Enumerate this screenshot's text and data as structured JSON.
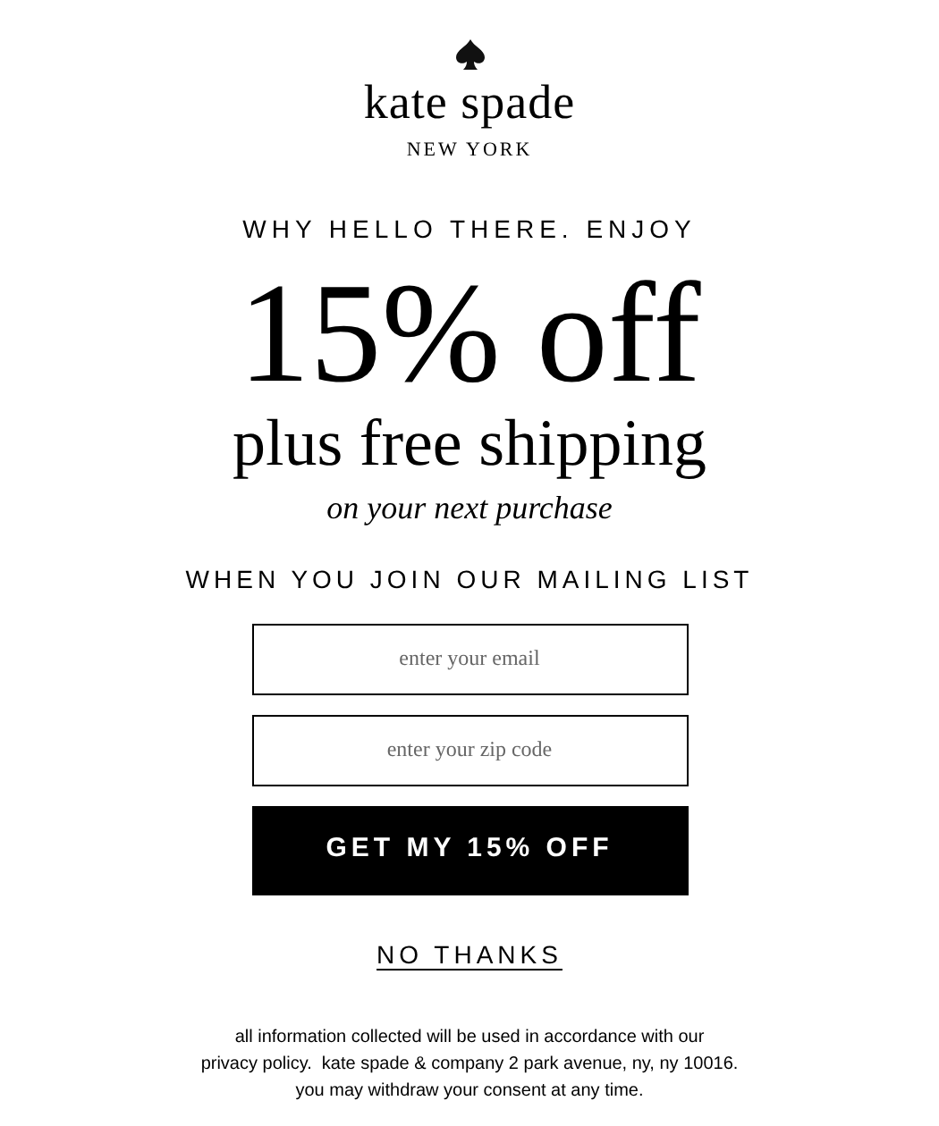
{
  "brand": {
    "name": "kate spade",
    "location": "NEW YORK"
  },
  "greeting": "WHY HELLO THERE. ENJOY",
  "offer": {
    "headline": "15% off",
    "subline": "plus free shipping",
    "note": "on your next purchase"
  },
  "prompt": "WHEN YOU JOIN OUR MAILING LIST",
  "fields": [
    {
      "placeholder": "enter your email"
    },
    {
      "placeholder": "enter your zip code"
    }
  ],
  "submit_button": "GET MY 15% OFF",
  "decline_link": "NO THANKS",
  "disclaimer": [
    "all information collected will be used in accordance with our",
    "privacy policy.  kate spade & company 2 park avenue, ny, ny 10016.",
    "you may withdraw your consent at any time."
  ]
}
